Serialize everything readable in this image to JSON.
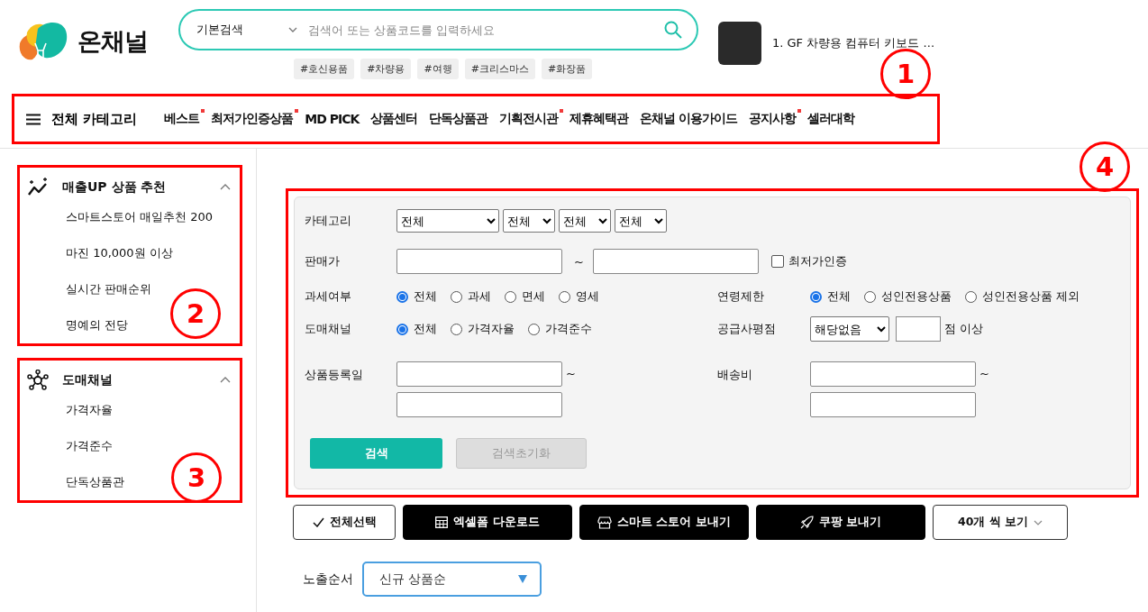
{
  "logo": {
    "text": "온채널"
  },
  "search": {
    "mode": "기본검색",
    "placeholder": "검색어 또는 상품코드를 입력하세요"
  },
  "tags": [
    "#호신용품",
    "#차량용",
    "#여행",
    "#크리스마스",
    "#화장품"
  ],
  "ranking": {
    "text": "1. GF 차량용 컴퓨터 키보드 ..."
  },
  "nav": {
    "all_categories": "전체 카테고리",
    "items": [
      {
        "label": "베스트",
        "new": true
      },
      {
        "label": "최저가인증상품",
        "new": true
      },
      {
        "label": "MD PICK",
        "new": false
      },
      {
        "label": "상품센터",
        "new": false
      },
      {
        "label": "단독상품관",
        "new": false
      },
      {
        "label": "기획전시관",
        "new": true
      },
      {
        "label": "제휴혜택관",
        "new": false
      },
      {
        "label": "온채널 이용가이드",
        "new": false
      },
      {
        "label": "공지사항",
        "new": true
      },
      {
        "label": "셀러대학",
        "new": false
      }
    ]
  },
  "sidebar": {
    "sections": [
      {
        "title": "매출UP 상품 추천",
        "expanded": true,
        "items": [
          "스마트스토어 매일추천 200",
          "마진 10,000원 이상",
          "실시간 판매순위",
          "명예의 전당"
        ]
      },
      {
        "title": "도매채널",
        "expanded": true,
        "items": [
          "가격자율",
          "가격준수",
          "단독상품관"
        ]
      }
    ]
  },
  "filters": {
    "category": {
      "label": "카테고리",
      "selects": [
        "전체",
        "전체",
        "전체",
        "전체"
      ]
    },
    "price": {
      "label": "판매가",
      "tilde": "~",
      "checkbox": {
        "label": "최저가인증",
        "checked": false
      }
    },
    "tax": {
      "label": "과세여부",
      "options": [
        {
          "label": "전체",
          "selected": true
        },
        {
          "label": "과세",
          "selected": false
        },
        {
          "label": "면세",
          "selected": false
        },
        {
          "label": "영세",
          "selected": false
        }
      ]
    },
    "age": {
      "label": "연령제한",
      "options": [
        {
          "label": "전체",
          "selected": true
        },
        {
          "label": "성인전용상품",
          "selected": false
        },
        {
          "label": "성인전용상품 제외",
          "selected": false
        }
      ]
    },
    "channel": {
      "label": "도매채널",
      "options": [
        {
          "label": "전체",
          "selected": true
        },
        {
          "label": "가격자율",
          "selected": false
        },
        {
          "label": "가격준수",
          "selected": false
        }
      ]
    },
    "rating": {
      "label": "공급사평점",
      "select": "해당없음",
      "suffix": "점 이상"
    },
    "date": {
      "label": "상품등록일",
      "tilde": "~"
    },
    "shipping": {
      "label": "배송비",
      "tilde": "~"
    },
    "search_button": {
      "label": "검색"
    },
    "reset_button": {
      "label": "검색초기화",
      "disabled": true
    }
  },
  "actions": [
    {
      "label": "전체선택",
      "kind": "outline"
    },
    {
      "label": "엑셀폼 다운로드",
      "kind": "dark"
    },
    {
      "label": "스마트 스토어 보내기",
      "kind": "dark"
    },
    {
      "label": "쿠팡 보내기",
      "kind": "dark"
    },
    {
      "label": "40개 씩 보기",
      "kind": "dropdown"
    }
  ],
  "sort": {
    "label": "노출순서",
    "value": "신규 상품순"
  },
  "annotations": [
    "1",
    "2",
    "3",
    "4"
  ]
}
